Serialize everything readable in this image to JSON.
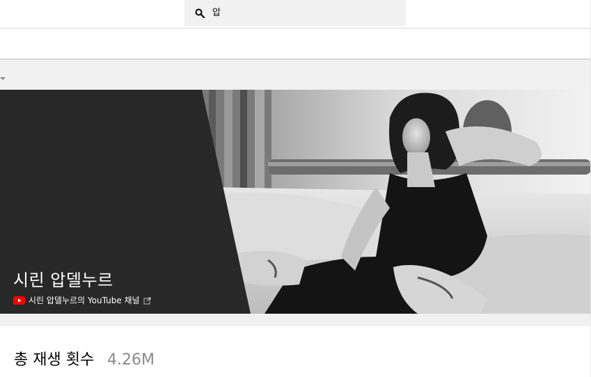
{
  "search": {
    "query": "압",
    "icon": "search-icon"
  },
  "banner": {
    "channel_name": "시린 압델누르",
    "channel_link": "시린 압델누르의 YouTube 채널",
    "icons": [
      "youtube-logo-icon",
      "external-link-icon"
    ]
  },
  "stats": {
    "label": "총 재생 횟수",
    "value": "4.26M"
  },
  "colors": {
    "youtube_red": "#ff0000",
    "banner_dark": "#2a2a2a",
    "value_gray": "#8a8a8a"
  }
}
